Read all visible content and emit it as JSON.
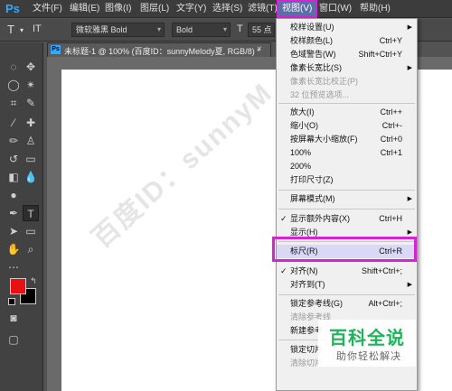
{
  "app": {
    "logo": "Ps"
  },
  "menubar": {
    "items": [
      "文件(F)",
      "编辑(E)",
      "图像(I)",
      "图层(L)",
      "文字(Y)",
      "选择(S)",
      "滤镜(T)",
      "视图(V)",
      "窗口(W)",
      "帮助(H)"
    ]
  },
  "options": {
    "tool_glyph": "T",
    "orient_glyph": "IT",
    "font_family": "微软雅黑 Bold",
    "font_style": "Bold",
    "size_glyph": "T",
    "font_size": "55 点"
  },
  "document": {
    "icon": "Ps",
    "title": "未标题-1 @ 100% (百度ID：sunnyMelody夏, RGB/8) *",
    "close": "×"
  },
  "view_menu": {
    "items": [
      {
        "label": "校样设置(U)",
        "shortcut": "",
        "submenu": true,
        "disabled": false
      },
      {
        "label": "校样颜色(L)",
        "shortcut": "Ctrl+Y",
        "submenu": false,
        "disabled": false
      },
      {
        "label": "色域警告(W)",
        "shortcut": "Shift+Ctrl+Y",
        "submenu": false,
        "disabled": false
      },
      {
        "label": "像素长宽比(S)",
        "shortcut": "",
        "submenu": true,
        "disabled": false
      },
      {
        "label": "像素长宽比校正(P)",
        "shortcut": "",
        "submenu": false,
        "disabled": true
      },
      {
        "label": "32 位预览选项...",
        "shortcut": "",
        "submenu": false,
        "disabled": true
      },
      {
        "label": "放大(I)",
        "shortcut": "Ctrl++",
        "submenu": false,
        "disabled": false
      },
      {
        "label": "缩小(O)",
        "shortcut": "Ctrl+-",
        "submenu": false,
        "disabled": false
      },
      {
        "label": "按屏幕大小缩放(F)",
        "shortcut": "Ctrl+0",
        "submenu": false,
        "disabled": false
      },
      {
        "label": "100%",
        "shortcut": "Ctrl+1",
        "submenu": false,
        "disabled": false
      },
      {
        "label": "200%",
        "shortcut": "",
        "submenu": false,
        "disabled": false
      },
      {
        "label": "打印尺寸(Z)",
        "shortcut": "",
        "submenu": false,
        "disabled": false
      },
      {
        "label": "屏幕模式(M)",
        "shortcut": "",
        "submenu": true,
        "disabled": false
      },
      {
        "label": "显示额外内容(X)",
        "shortcut": "Ctrl+H",
        "submenu": false,
        "disabled": false,
        "checked": true
      },
      {
        "label": "显示(H)",
        "shortcut": "",
        "submenu": true,
        "disabled": false
      },
      {
        "label": "标尺(R)",
        "shortcut": "Ctrl+R",
        "submenu": false,
        "disabled": false,
        "highlighted": true
      },
      {
        "label": "对齐(N)",
        "shortcut": "Shift+Ctrl+;",
        "submenu": false,
        "disabled": false,
        "checked": true
      },
      {
        "label": "对齐到(T)",
        "shortcut": "",
        "submenu": true,
        "disabled": false
      },
      {
        "label": "锁定参考线(G)",
        "shortcut": "Alt+Ctrl+;",
        "submenu": false,
        "disabled": false
      },
      {
        "label": "清除参考线",
        "shortcut": "",
        "submenu": false,
        "disabled": true
      },
      {
        "label": "新建参考",
        "shortcut": "",
        "submenu": false,
        "disabled": false
      },
      {
        "label": "锁定切片",
        "shortcut": "",
        "submenu": false,
        "disabled": false
      },
      {
        "label": "清除切片",
        "shortcut": "",
        "submenu": false,
        "disabled": true
      }
    ],
    "check_glyph": "✓",
    "arrow_glyph": "▶"
  },
  "watermark": {
    "text": "百度ID：sunnyM"
  },
  "baike": {
    "title": "百科全说",
    "subtitle": "助你轻松解决"
  },
  "colors": {
    "accent_highlight": "#d524d2",
    "foreground": "#e81010",
    "background": "#000000"
  }
}
